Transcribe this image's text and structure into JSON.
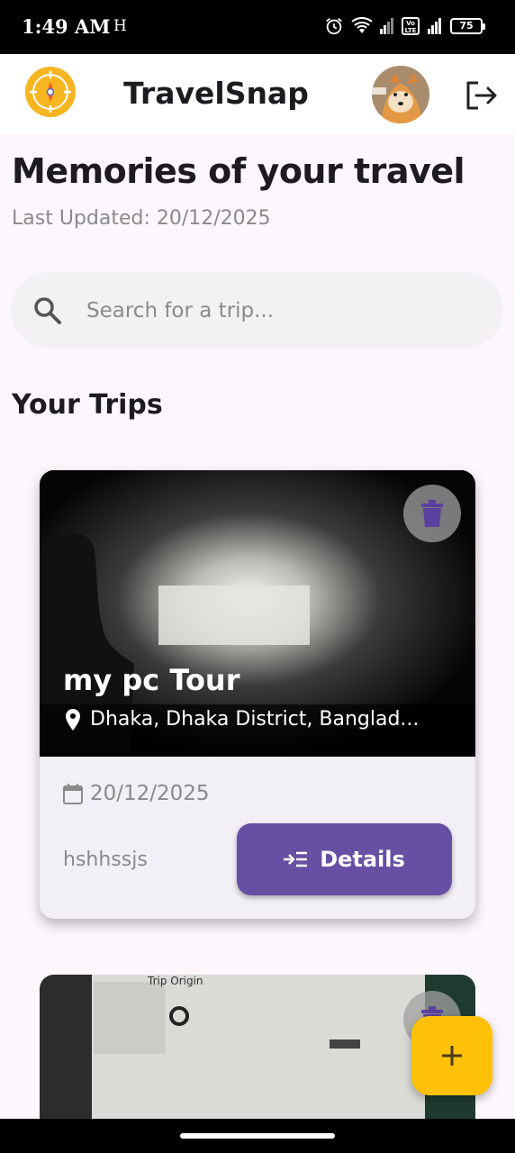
{
  "status_bar": {
    "time": "1:49 AM",
    "carrier": "H",
    "volte": "Vo LTE",
    "battery": "75"
  },
  "app_bar": {
    "title": "TravelSnap"
  },
  "header": {
    "title": "Memories of your travel",
    "last_updated": "Last Updated: 20/12/2025"
  },
  "search": {
    "placeholder": "Search for a trip..."
  },
  "section": {
    "title": "Your Trips"
  },
  "trips": [
    {
      "name": "my pc Tour",
      "location": "Dhaka, Dhaka District, Banglad...",
      "date": "20/12/2025",
      "description": "hshhssjs",
      "details_label": "Details"
    },
    {
      "photo_text": "Trip Origin"
    }
  ],
  "colors": {
    "primary": "#6750a4",
    "fab": "#ffc107",
    "background": "#fdf7fd"
  },
  "icons": [
    "compass-logo-icon",
    "logout-icon",
    "search-icon",
    "delete-icon",
    "location-pin-icon",
    "calendar-icon",
    "details-icon",
    "add-icon"
  ]
}
